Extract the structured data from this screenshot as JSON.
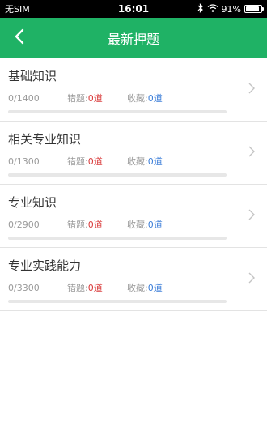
{
  "status_bar": {
    "carrier": "无SIM",
    "time": "16:01",
    "battery": "91%",
    "battery_level": 0.91
  },
  "nav": {
    "title": "最新押题"
  },
  "colors": {
    "accent": "#1fb265",
    "error_number": "#d93a3a",
    "favorite_number": "#3c7ed8"
  },
  "items": [
    {
      "title": "基础知识",
      "progress": "0/1400",
      "progress_fraction": 0,
      "errors_label": "错题:",
      "errors_value": "0道",
      "fav_label": "收藏:",
      "fav_value": "0道"
    },
    {
      "title": "相关专业知识",
      "progress": "0/1300",
      "progress_fraction": 0,
      "errors_label": "错题:",
      "errors_value": "0道",
      "fav_label": "收藏:",
      "fav_value": "0道"
    },
    {
      "title": "专业知识",
      "progress": "0/2900",
      "progress_fraction": 0,
      "errors_label": "错题:",
      "errors_value": "0道",
      "fav_label": "收藏:",
      "fav_value": "0道"
    },
    {
      "title": "专业实践能力",
      "progress": "0/3300",
      "progress_fraction": 0,
      "errors_label": "错题:",
      "errors_value": "0道",
      "fav_label": "收藏:",
      "fav_value": "0道"
    }
  ]
}
